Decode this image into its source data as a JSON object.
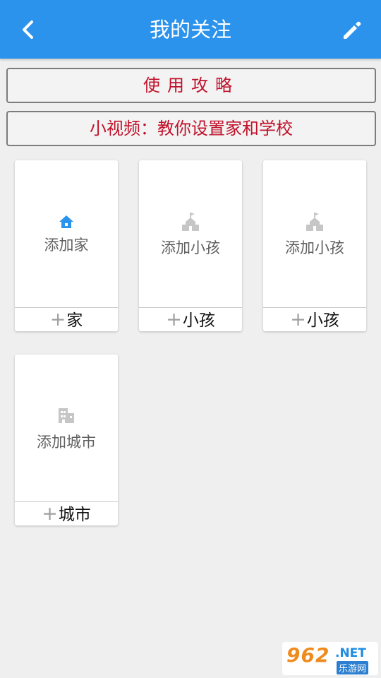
{
  "header": {
    "title": "我的关注",
    "back_icon": "chevron-left-icon",
    "edit_icon": "pencil-icon",
    "color": "#2b93ec"
  },
  "banners": {
    "guide": "使用攻略",
    "video": "小视频：教你设置家和学校",
    "text_color": "#c0122b"
  },
  "cards": [
    {
      "label": "添加家",
      "footer": "家",
      "icon": "home-icon",
      "icon_color": "#2b93ec"
    },
    {
      "label": "添加小孩",
      "footer": "小孩",
      "icon": "school-icon",
      "icon_color": "#c6c6c6"
    },
    {
      "label": "添加小孩",
      "footer": "小孩",
      "icon": "school-icon",
      "icon_color": "#c6c6c6"
    },
    {
      "label": "添加城市",
      "footer": "城市",
      "icon": "building-icon",
      "icon_color": "#c6c6c6"
    }
  ],
  "plus_symbol": "+",
  "watermark": {
    "number": "962",
    "suffix": ".NET",
    "subtitle": "乐游网"
  }
}
